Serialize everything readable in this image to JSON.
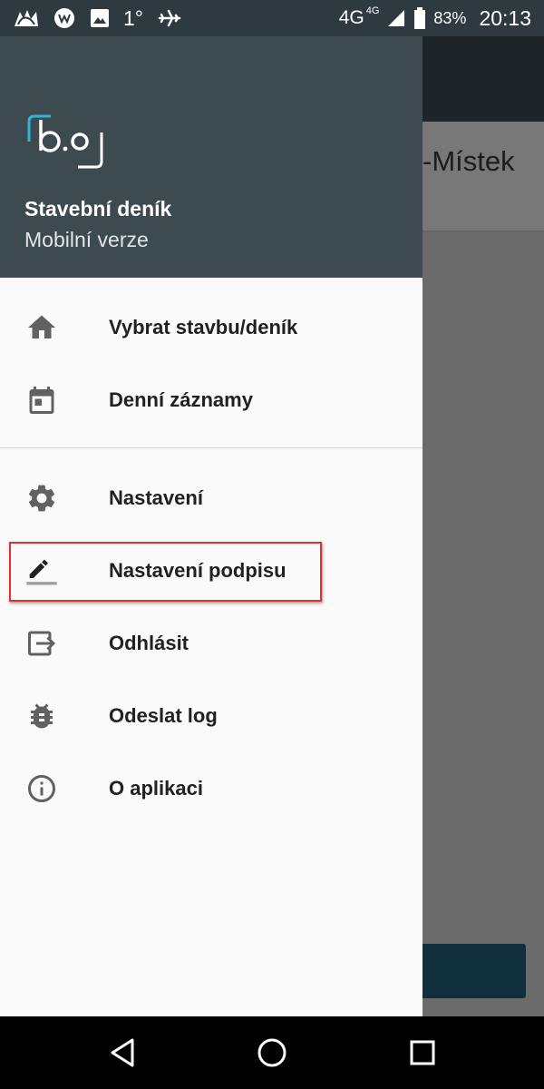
{
  "status_bar": {
    "temperature": "1°",
    "network": "4G",
    "network_small": "4G",
    "battery": "83%",
    "time": "20:13"
  },
  "background_app": {
    "title": "-Místek"
  },
  "drawer": {
    "app_title": "Stavební deník",
    "app_subtitle": "Mobilní verze",
    "items": [
      {
        "label": "Vybrat stavbu/deník",
        "icon": "home-icon"
      },
      {
        "label": "Denní záznamy",
        "icon": "calendar-icon"
      },
      {
        "label": "Nastavení",
        "icon": "gear-icon"
      },
      {
        "label": "Nastavení podpisu",
        "icon": "pencil-icon"
      },
      {
        "label": "Odhlásit",
        "icon": "logout-icon"
      },
      {
        "label": "Odeslat log",
        "icon": "bug-icon"
      },
      {
        "label": "O aplikaci",
        "icon": "info-icon"
      }
    ]
  },
  "colors": {
    "drawer_header": "#3d4a50",
    "status_bar": "#2e3a40",
    "highlight": "#e03131",
    "logo_accent": "#2bb8d6"
  }
}
